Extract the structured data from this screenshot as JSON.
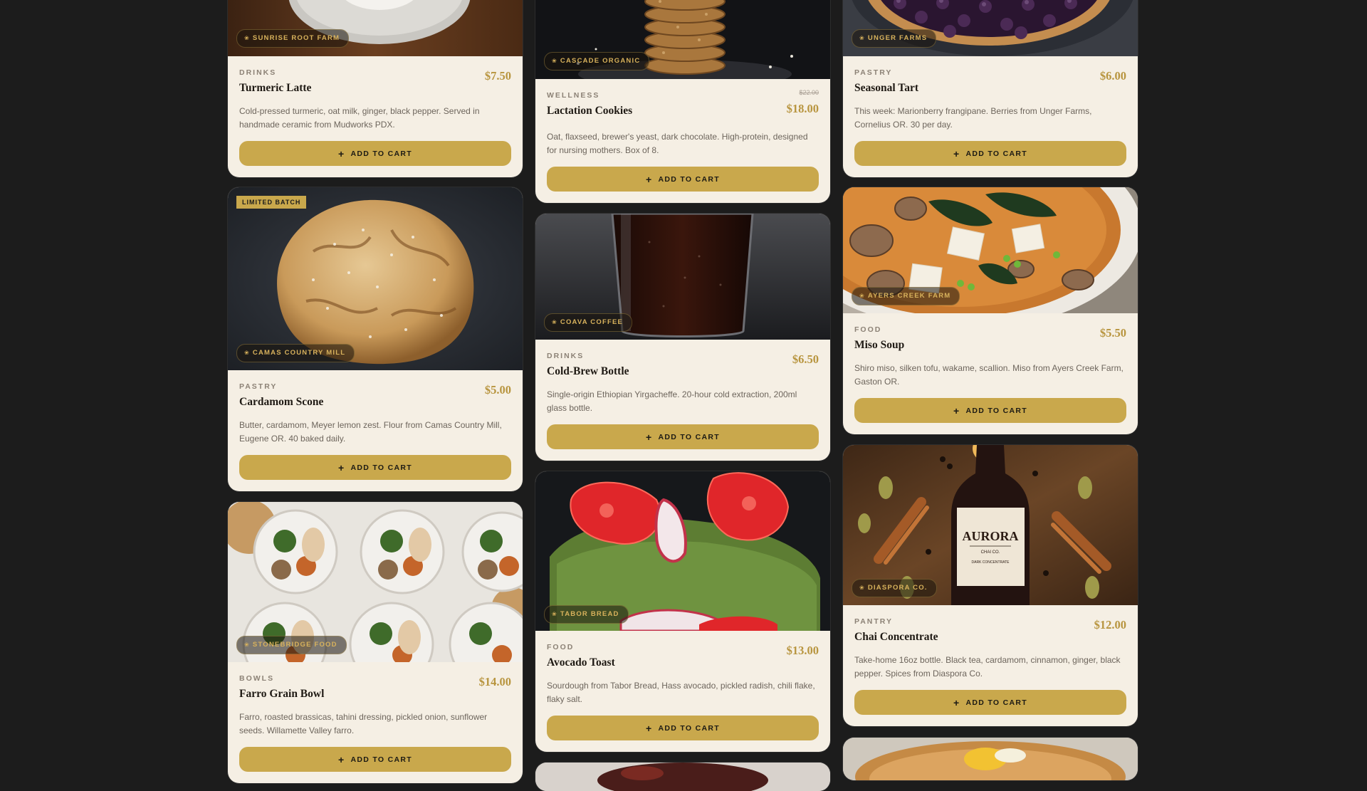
{
  "theme": {
    "accent": "#c9a84c",
    "background": "#1c1c1c",
    "card": "#f5efe4"
  },
  "products": [
    {
      "category": "DRINKS",
      "name": "Turmeric Latte",
      "price": "$7.50",
      "supplier": "SUNRISE ROOT FARM",
      "description": "Cold-pressed turmeric, oat milk, ginger, black pepper. Served in handmade ceramic from Mudworks PDX.",
      "button": "ADD TO CART"
    },
    {
      "category": "PASTRY",
      "name": "Cardamom Scone",
      "price": "$5.00",
      "supplier": "CAMAS COUNTRY MILL",
      "badge": "LIMITED BATCH",
      "description": "Butter, cardamom, Meyer lemon zest. Flour from Camas Country Mill, Eugene OR. 40 baked daily.",
      "button": "ADD TO CART"
    },
    {
      "category": "BOWLS",
      "name": "Farro Grain Bowl",
      "price": "$14.00",
      "supplier": "STONEBRIDGE FOOD",
      "description": "Farro, roasted brassicas, tahini dressing, pickled onion, sunflower seeds. Willamette Valley farro.",
      "button": "ADD TO CART"
    },
    {
      "category": "WELLNESS",
      "name": "Lactation Cookies",
      "price": "$18.00",
      "old_price": "$22.00",
      "supplier": "CASCADE ORGANIC",
      "description": "Oat, flaxseed, brewer's yeast, dark chocolate. High-protein, designed for nursing mothers. Box of 8.",
      "button": "ADD TO CART"
    },
    {
      "category": "DRINKS",
      "name": "Cold-Brew Bottle",
      "price": "$6.50",
      "supplier": "COAVA COFFEE",
      "description": "Single-origin Ethiopian Yirgacheffe. 20-hour cold extraction, 200ml glass bottle.",
      "button": "ADD TO CART"
    },
    {
      "category": "FOOD",
      "name": "Avocado Toast",
      "price": "$13.00",
      "supplier": "TABOR BREAD",
      "description": "Sourdough from Tabor Bread, Hass avocado, pickled radish, chili flake, flaky salt.",
      "button": "ADD TO CART"
    },
    {
      "category": "PASTRY",
      "name": "Seasonal Tart",
      "price": "$6.00",
      "supplier": "UNGER FARMS",
      "description": "This week: Marionberry frangipane. Berries from Unger Farms, Cornelius OR. 30 per day.",
      "button": "ADD TO CART"
    },
    {
      "category": "FOOD",
      "name": "Miso Soup",
      "price": "$5.50",
      "supplier": "AYERS CREEK FARM",
      "description": "Shiro miso, silken tofu, wakame, scallion. Miso from Ayers Creek Farm, Gaston OR.",
      "button": "ADD TO CART"
    },
    {
      "category": "PANTRY",
      "name": "Chai Concentrate",
      "price": "$12.00",
      "supplier": "DIASPORA CO.",
      "description": "Take-home 16oz bottle. Black tea, cardamom, cinnamon, ginger, black pepper. Spices from Diaspora Co.",
      "button": "ADD TO CART"
    }
  ],
  "bottle_label": {
    "brand": "AURORA",
    "sub": "CHAI CO.",
    "line": "DARK CONCENTRATE"
  }
}
